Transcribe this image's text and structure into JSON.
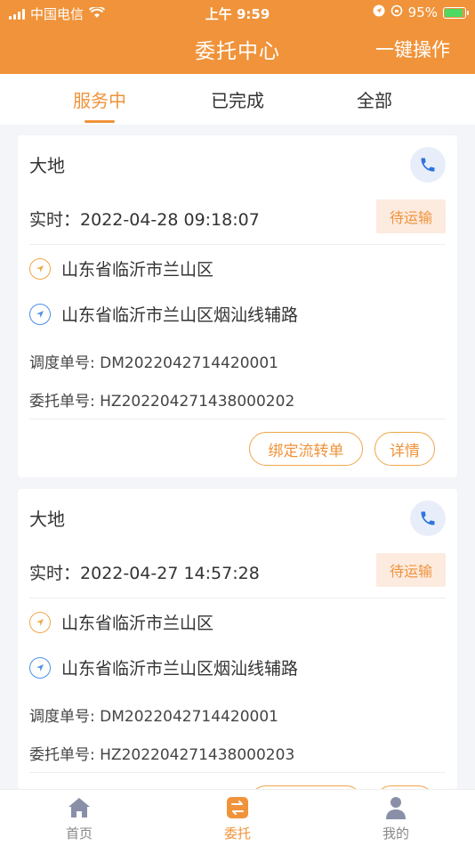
{
  "status_bar": {
    "carrier": "中国电信",
    "time": "上午 9:59",
    "battery": "95%"
  },
  "nav": {
    "title": "委托中心",
    "action": "一键操作"
  },
  "tabs": [
    {
      "label": "服务中",
      "active": true
    },
    {
      "label": "已完成",
      "active": false
    },
    {
      "label": "全部",
      "active": false
    }
  ],
  "orders": [
    {
      "company": "大地",
      "time_label": "实时：",
      "time_value": "2022-04-28 09:18:07",
      "status": "待运输",
      "from": "山东省临沂市兰山区",
      "to": "山东省临沂市兰山区烟汕线辅路",
      "dispatch_label": "调度单号:",
      "dispatch_no": "DM2022042714420001",
      "entrust_label": "委托单号:",
      "entrust_no": "HZ20220427143800020 2",
      "bind_label": "绑定流转单",
      "detail_label": "详情"
    },
    {
      "company": "大地",
      "time_label": "实时：",
      "time_value": "2022-04-27 14:57:28",
      "status": "待运输",
      "from": "山东省临沂市兰山区",
      "to": "山东省临沂市兰山区烟汕线辅路",
      "dispatch_label": "调度单号:",
      "dispatch_no": "DM2022042714420001",
      "entrust_label": "委托单号:",
      "entrust_no": "HZ202204271438000203"
    }
  ],
  "bottom_nav": [
    {
      "label": "首页",
      "icon": "home-icon",
      "active": false
    },
    {
      "label": "委托",
      "icon": "transfer-icon",
      "active": true
    },
    {
      "label": "我的",
      "icon": "user-icon",
      "active": false
    }
  ],
  "colors": {
    "brand": "#f0933a",
    "badge_bg": "#fdebe0",
    "phone_bg": "#e8eef9",
    "from_icon": "#f0a64a",
    "to_icon": "#4a8ee6"
  }
}
